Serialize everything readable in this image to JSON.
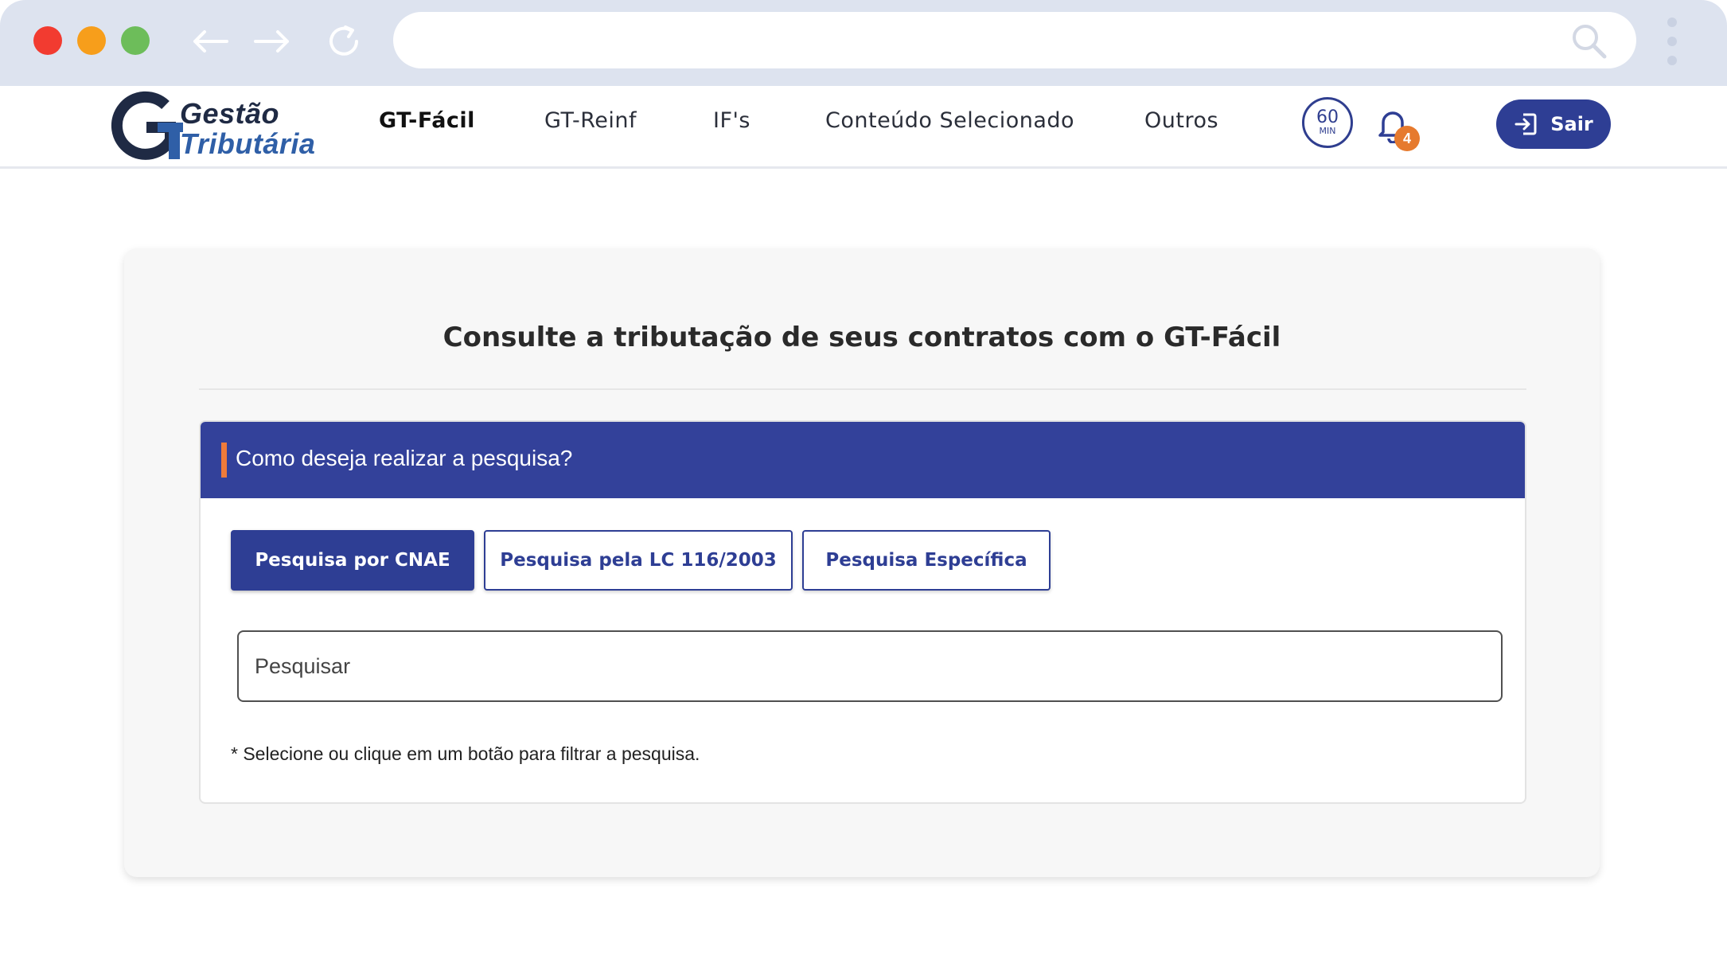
{
  "browser": {
    "url": "",
    "controls": [
      "back-arrow",
      "forward-arrow",
      "reload"
    ]
  },
  "brand": {
    "line1": "Gestão",
    "line2": "Tributária"
  },
  "nav": {
    "items": [
      {
        "label": "GT-Fácil",
        "active": true
      },
      {
        "label": "GT-Reinf",
        "active": false
      },
      {
        "label": "IF's",
        "active": false
      },
      {
        "label": "Conteúdo Selecionado",
        "active": false
      },
      {
        "label": "Outros",
        "active": false
      }
    ]
  },
  "header": {
    "timer_value": "60",
    "timer_unit": "MIN",
    "notification_count": "4",
    "logout_label": "Sair"
  },
  "main": {
    "title": "Consulte a tributação de seus contratos com o GT-Fácil",
    "panel_heading": "Como deseja realizar a pesquisa?",
    "filters": [
      {
        "label": "Pesquisa por CNAE",
        "selected": true
      },
      {
        "label": "Pesquisa pela LC 116/2003",
        "selected": false
      },
      {
        "label": "Pesquisa Específica",
        "selected": false
      }
    ],
    "search": {
      "placeholder": "Pesquisar",
      "value": ""
    },
    "hint": "* Selecione ou clique em um botão para filtrar a pesquisa."
  },
  "colors": {
    "primary": "#2e3e94",
    "accent": "#ef7b3a",
    "badge": "#e67a2e",
    "chrome": "#dde3ef"
  }
}
